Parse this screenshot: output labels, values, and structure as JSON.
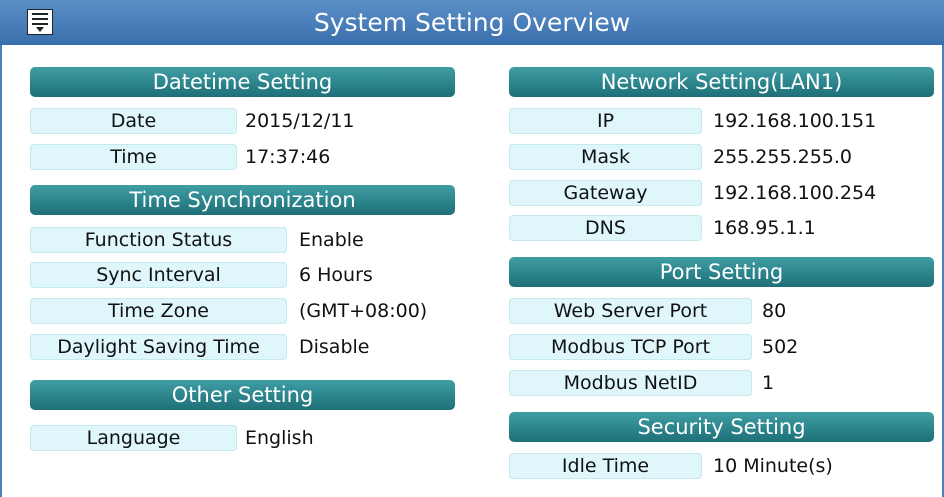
{
  "header": {
    "title": "System Setting Overview",
    "menu_icon": "menu-icon"
  },
  "datetime": {
    "title": "Datetime Setting",
    "date_label": "Date",
    "date_value": "2015/12/11",
    "time_label": "Time",
    "time_value": "17:37:46"
  },
  "sync": {
    "title": "Time Synchronization",
    "status_label": "Function Status",
    "status_value": "Enable",
    "interval_label": "Sync Interval",
    "interval_value": "6 Hours",
    "zone_label": "Time Zone",
    "zone_value": "(GMT+08:00)",
    "dst_label": "Daylight Saving Time",
    "dst_value": "Disable"
  },
  "other": {
    "title": "Other Setting",
    "language_label": "Language",
    "language_value": "English"
  },
  "network": {
    "title": "Network Setting(LAN1)",
    "ip_label": "IP",
    "ip_value": "192.168.100.151",
    "mask_label": "Mask",
    "mask_value": "255.255.255.0",
    "gateway_label": "Gateway",
    "gateway_value": "192.168.100.254",
    "dns_label": "DNS",
    "dns_value": "168.95.1.1"
  },
  "port": {
    "title": "Port Setting",
    "web_label": "Web Server Port",
    "web_value": "80",
    "modbus_tcp_label": "Modbus TCP Port",
    "modbus_tcp_value": "502",
    "netid_label": "Modbus NetID",
    "netid_value": "1"
  },
  "security": {
    "title": "Security Setting",
    "idle_label": "Idle Time",
    "idle_value": "10 Minute(s)"
  },
  "colors": {
    "title_bar": "#4a7fbf",
    "section_header": "#2a8189",
    "label_bg": "#dff7fb"
  }
}
